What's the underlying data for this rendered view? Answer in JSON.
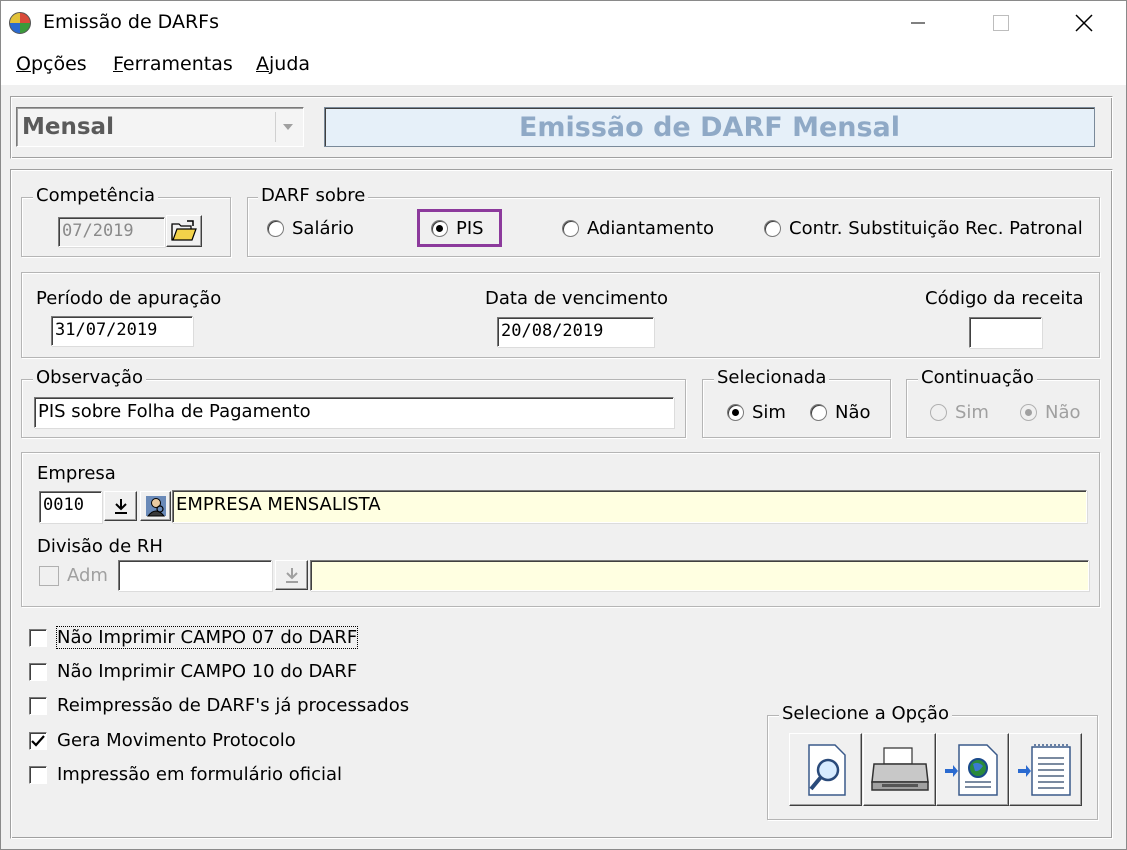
{
  "window": {
    "title": "Emissão de DARFs"
  },
  "menu": [
    {
      "label": "Opções",
      "accel": "O",
      "rest": "pções"
    },
    {
      "label": "Ferramentas",
      "accel": "F",
      "rest": "erramentas"
    },
    {
      "label": "Ajuda",
      "accel": "A",
      "rest": "juda"
    }
  ],
  "header": {
    "period_select": "Mensal",
    "banner": "Emissão de DARF Mensal"
  },
  "competencia": {
    "legend": "Competência",
    "value": "07/2019"
  },
  "darf_sobre": {
    "legend": "DARF sobre",
    "options": [
      {
        "label": "Salário",
        "selected": false
      },
      {
        "label": "PIS",
        "selected": true
      },
      {
        "label": "Adiantamento",
        "selected": false
      },
      {
        "label": "Contr. Substituição Rec. Patronal",
        "selected": false
      }
    ]
  },
  "datas": {
    "periodo_label": "Período de apuração",
    "periodo_value": "31/07/2019",
    "vencimento_label": "Data de vencimento",
    "vencimento_value": "20/08/2019",
    "codigo_label": "Código da receita",
    "codigo_value": ""
  },
  "observacao": {
    "legend": "Observação",
    "value": "PIS sobre Folha de Pagamento"
  },
  "selecionada": {
    "legend": "Selecionada",
    "options": [
      {
        "label": "Sim",
        "selected": true
      },
      {
        "label": "Não",
        "selected": false
      }
    ]
  },
  "continuacao": {
    "legend": "Continuação",
    "options": [
      {
        "label": "Sim",
        "selected": false
      },
      {
        "label": "Não",
        "selected": true
      }
    ]
  },
  "empresa": {
    "label": "Empresa",
    "code": "0010",
    "name": "EMPRESA MENSALISTA"
  },
  "divisao": {
    "label": "Divisão de RH",
    "adm_label": "Adm",
    "code": "",
    "name": ""
  },
  "options": [
    {
      "label": "Não Imprimir CAMPO 07 do DARF",
      "checked": false
    },
    {
      "label": "Não Imprimir CAMPO 10 do DARF",
      "checked": false
    },
    {
      "label": "Reimpressão de DARF's já processados",
      "checked": false
    },
    {
      "label": "Gera Movimento Protocolo",
      "checked": true
    },
    {
      "label": "Impressão em formulário oficial",
      "checked": false
    }
  ],
  "selecione": {
    "legend": "Selecione a Opção",
    "buttons": [
      "preview-icon",
      "printer-icon",
      "export-web-icon",
      "export-file-icon"
    ]
  },
  "colors": {
    "banner_text": "#8fa9c6",
    "banner_bg": "#e6f0f9",
    "highlight": "#8c3a9c",
    "yellow_field": "#ffffe1"
  }
}
